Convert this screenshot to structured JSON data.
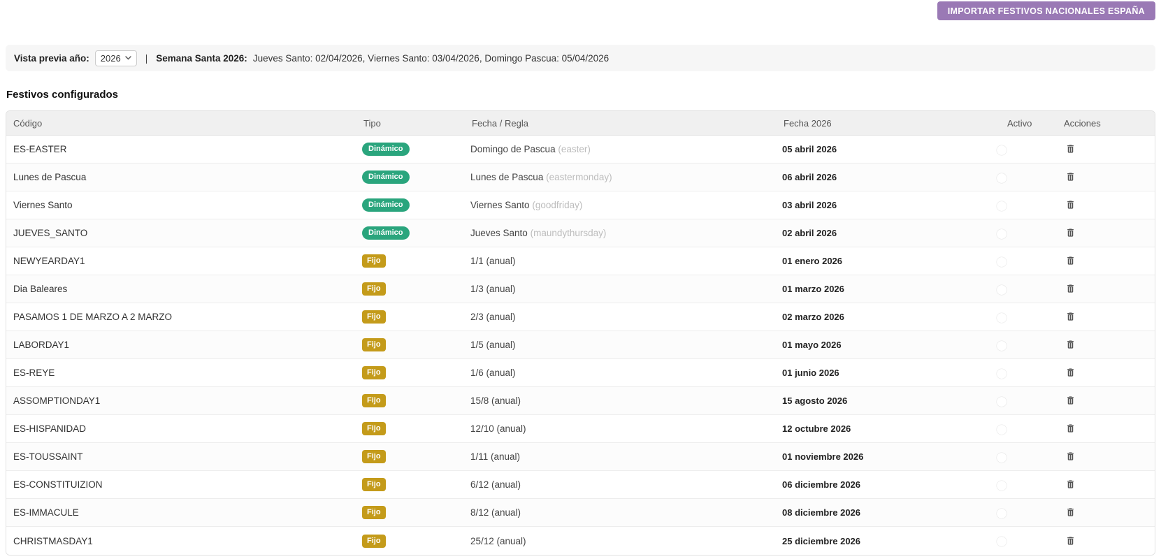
{
  "colors": {
    "badge_dynamic": "#2aa57d",
    "badge_fixed": "#c49b1a",
    "toggle_on": "#2aa57d",
    "button_purple": "#9a79b5"
  },
  "import_button_label": "IMPORTAR FESTIVOS NACIONALES ESPAÑA",
  "preview_bar": {
    "label": "Vista previa año:",
    "year": "2026",
    "separator": "|",
    "semana_santa_label": "Semana Santa 2026:",
    "semana_santa_text": "Jueves Santo: 02/04/2026, Viernes Santo: 03/04/2026, Domingo Pascua: 05/04/2026"
  },
  "section_title": "Festivos configurados",
  "table": {
    "headers": [
      "Código",
      "Tipo",
      "Fecha / Regla",
      "Fecha 2026",
      "Activo",
      "Acciones"
    ],
    "rows": [
      {
        "codigo": "ES-EASTER",
        "tipo": "Dinámico",
        "rule": "Domingo de Pascua",
        "rule_hint": "(easter)",
        "fecha": "05 abril 2026",
        "activo": true
      },
      {
        "codigo": "Lunes de Pascua",
        "tipo": "Dinámico",
        "rule": "Lunes de Pascua",
        "rule_hint": "(eastermonday)",
        "fecha": "06 abril 2026",
        "activo": true
      },
      {
        "codigo": "Viernes Santo",
        "tipo": "Dinámico",
        "rule": "Viernes Santo",
        "rule_hint": "(goodfriday)",
        "fecha": "03 abril 2026",
        "activo": true
      },
      {
        "codigo": "JUEVES_SANTO",
        "tipo": "Dinámico",
        "rule": "Jueves Santo",
        "rule_hint": "(maundythursday)",
        "fecha": "02 abril 2026",
        "activo": true
      },
      {
        "codigo": "NEWYEARDAY1",
        "tipo": "Fijo",
        "rule": "1/1 (anual)",
        "rule_hint": "",
        "fecha": "01 enero 2026",
        "activo": true
      },
      {
        "codigo": "Dia Baleares",
        "tipo": "Fijo",
        "rule": "1/3 (anual)",
        "rule_hint": "",
        "fecha": "01 marzo 2026",
        "activo": true
      },
      {
        "codigo": "PASAMOS 1 DE MARZO A 2 MARZO",
        "tipo": "Fijo",
        "rule": "2/3 (anual)",
        "rule_hint": "",
        "fecha": "02 marzo 2026",
        "activo": true
      },
      {
        "codigo": "LABORDAY1",
        "tipo": "Fijo",
        "rule": "1/5 (anual)",
        "rule_hint": "",
        "fecha": "01 mayo 2026",
        "activo": true
      },
      {
        "codigo": "ES-REYE",
        "tipo": "Fijo",
        "rule": "1/6 (anual)",
        "rule_hint": "",
        "fecha": "01 junio 2026",
        "activo": true
      },
      {
        "codigo": "ASSOMPTIONDAY1",
        "tipo": "Fijo",
        "rule": "15/8 (anual)",
        "rule_hint": "",
        "fecha": "15 agosto 2026",
        "activo": true
      },
      {
        "codigo": "ES-HISPANIDAD",
        "tipo": "Fijo",
        "rule": "12/10 (anual)",
        "rule_hint": "",
        "fecha": "12 octubre 2026",
        "activo": true
      },
      {
        "codigo": "ES-TOUSSAINT",
        "tipo": "Fijo",
        "rule": "1/11 (anual)",
        "rule_hint": "",
        "fecha": "01 noviembre 2026",
        "activo": true
      },
      {
        "codigo": "ES-CONSTITUIZION",
        "tipo": "Fijo",
        "rule": "6/12 (anual)",
        "rule_hint": "",
        "fecha": "06 diciembre 2026",
        "activo": true
      },
      {
        "codigo": "ES-IMMACULE",
        "tipo": "Fijo",
        "rule": "8/12 (anual)",
        "rule_hint": "",
        "fecha": "08 diciembre 2026",
        "activo": true
      },
      {
        "codigo": "CHRISTMASDAY1",
        "tipo": "Fijo",
        "rule": "25/12 (anual)",
        "rule_hint": "",
        "fecha": "25 diciembre 2026",
        "activo": true
      }
    ]
  }
}
